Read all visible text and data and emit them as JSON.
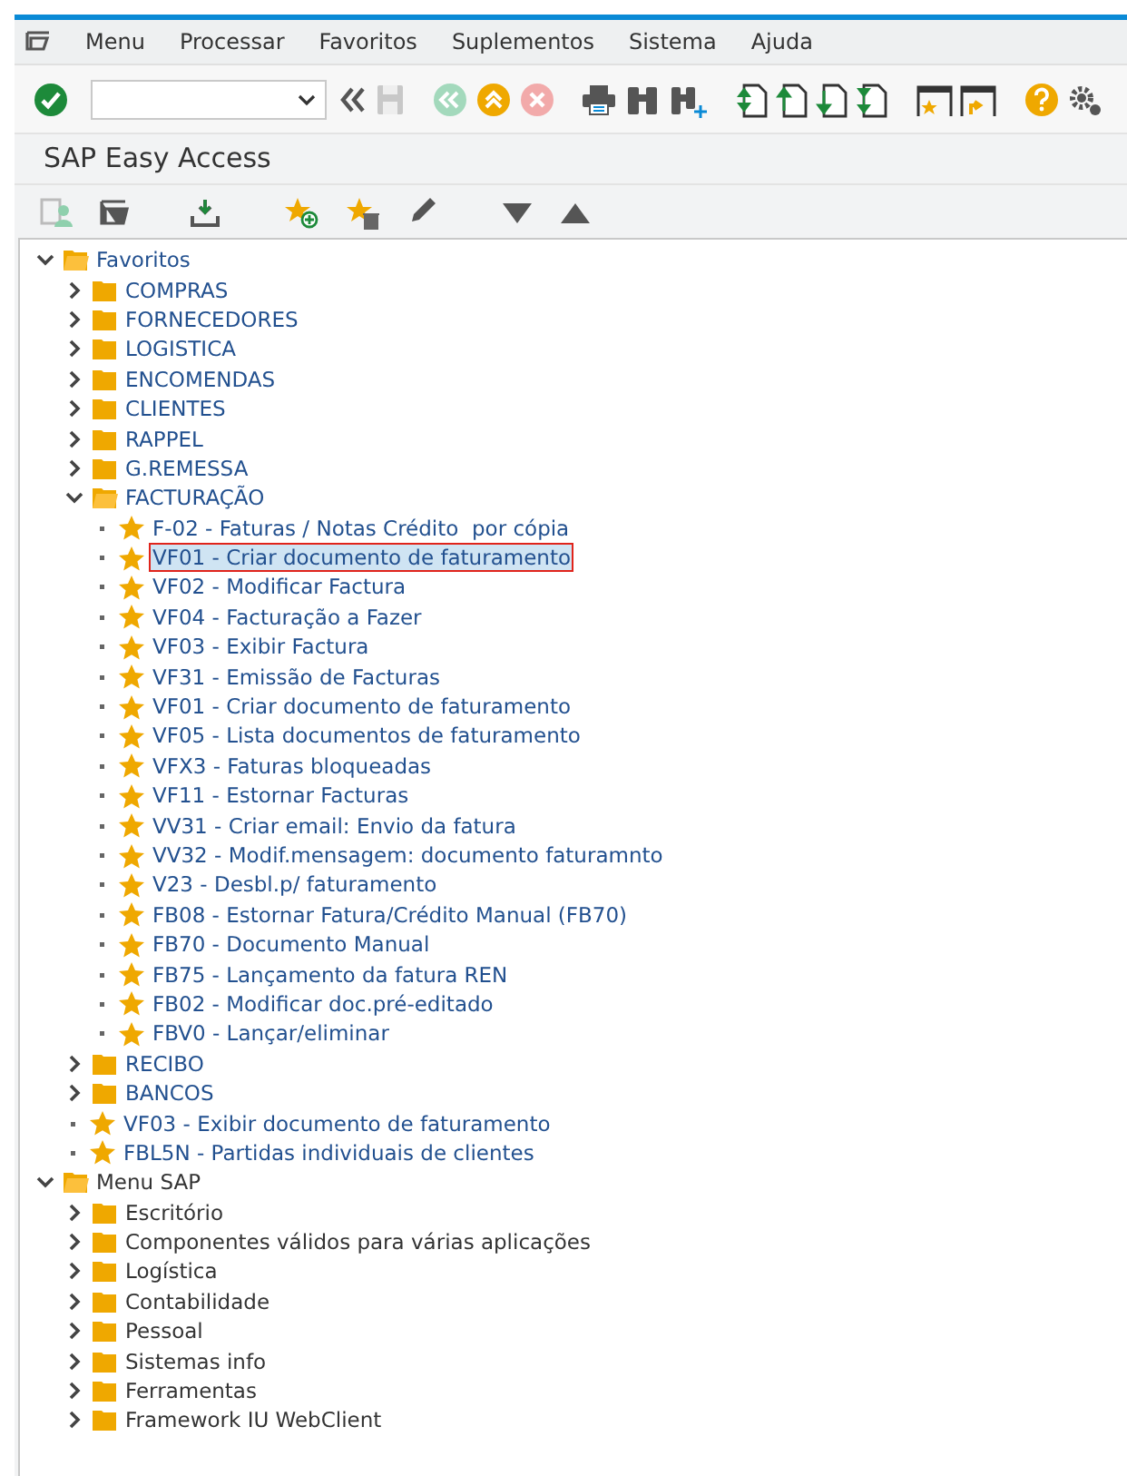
{
  "menu_bar": {
    "items": [
      "Menu",
      "Processar",
      "Favoritos",
      "Suplementos",
      "Sistema",
      "Ajuda"
    ]
  },
  "screen_title": "SAP Easy Access",
  "tree": [
    {
      "kind": "folder",
      "label": "Favoritos",
      "expanded": true,
      "selected": false,
      "children": [
        {
          "kind": "folder",
          "label": "COMPRAS",
          "expanded": false,
          "selected": false
        },
        {
          "kind": "folder",
          "label": "FORNECEDORES",
          "expanded": false,
          "selected": false
        },
        {
          "kind": "folder",
          "label": "LOGISTICA",
          "expanded": false,
          "selected": false
        },
        {
          "kind": "folder",
          "label": "ENCOMENDAS",
          "expanded": false,
          "selected": false
        },
        {
          "kind": "folder",
          "label": "CLIENTES",
          "expanded": false,
          "selected": false
        },
        {
          "kind": "folder",
          "label": "RAPPEL",
          "expanded": false,
          "selected": false
        },
        {
          "kind": "folder",
          "label": "G.REMESSA",
          "expanded": false,
          "selected": false
        },
        {
          "kind": "folder",
          "label": "FACTURAÇÃO",
          "expanded": true,
          "selected": false,
          "children": [
            {
              "kind": "transaction",
              "label": "F-02 - Faturas / Notas Crédito  por cópia",
              "selected": false
            },
            {
              "kind": "transaction",
              "label": "VF01 - Criar documento de faturamento",
              "selected": true
            },
            {
              "kind": "transaction",
              "label": "VF02 - Modificar Factura",
              "selected": false
            },
            {
              "kind": "transaction",
              "label": "VF04 - Facturação a Fazer",
              "selected": false
            },
            {
              "kind": "transaction",
              "label": "VF03 - Exibir Factura",
              "selected": false
            },
            {
              "kind": "transaction",
              "label": "VF31 - Emissão de Facturas",
              "selected": false
            },
            {
              "kind": "transaction",
              "label": "VF01 - Criar documento de faturamento",
              "selected": false
            },
            {
              "kind": "transaction",
              "label": "VF05 - Lista documentos de faturamento",
              "selected": false
            },
            {
              "kind": "transaction",
              "label": "VFX3 - Faturas bloqueadas",
              "selected": false
            },
            {
              "kind": "transaction",
              "label": "VF11 - Estornar Facturas",
              "selected": false
            },
            {
              "kind": "transaction",
              "label": "VV31 - Criar email: Envio da fatura",
              "selected": false
            },
            {
              "kind": "transaction",
              "label": "VV32 - Modif.mensagem: documento faturamnto",
              "selected": false
            },
            {
              "kind": "transaction",
              "label": "V23 - Desbl.p/ faturamento",
              "selected": false
            },
            {
              "kind": "transaction",
              "label": "FB08 - Estornar Fatura/Crédito Manual (FB70)",
              "selected": false
            },
            {
              "kind": "transaction",
              "label": "FB70 - Documento Manual",
              "selected": false
            },
            {
              "kind": "transaction",
              "label": "FB75 - Lançamento da fatura REN",
              "selected": false
            },
            {
              "kind": "transaction",
              "label": "FB02 - Modificar doc.pré-editado",
              "selected": false
            },
            {
              "kind": "transaction",
              "label": "FBV0 - Lançar/eliminar",
              "selected": false
            }
          ]
        },
        {
          "kind": "folder",
          "label": "RECIBO",
          "expanded": false,
          "selected": false
        },
        {
          "kind": "folder",
          "label": "BANCOS",
          "expanded": false,
          "selected": false
        },
        {
          "kind": "transaction",
          "label": "VF03 - Exibir documento de faturamento",
          "selected": false
        },
        {
          "kind": "transaction",
          "label": "FBL5N - Partidas individuais de clientes",
          "selected": false
        }
      ]
    },
    {
      "kind": "menu_folder",
      "label": "Menu SAP",
      "expanded": true,
      "selected": false,
      "children": [
        {
          "kind": "menu_folder",
          "label": "Escritório",
          "expanded": false,
          "selected": false
        },
        {
          "kind": "menu_folder",
          "label": "Componentes válidos para várias aplicações",
          "expanded": false,
          "selected": false
        },
        {
          "kind": "menu_folder",
          "label": "Logística",
          "expanded": false,
          "selected": false
        },
        {
          "kind": "menu_folder",
          "label": "Contabilidade",
          "expanded": false,
          "selected": false
        },
        {
          "kind": "menu_folder",
          "label": "Pessoal",
          "expanded": false,
          "selected": false
        },
        {
          "kind": "menu_folder",
          "label": "Sistemas info",
          "expanded": false,
          "selected": false
        },
        {
          "kind": "menu_folder",
          "label": "Ferramentas",
          "expanded": false,
          "selected": false
        },
        {
          "kind": "menu_folder",
          "label": "Framework IU WebClient",
          "expanded": false,
          "selected": false
        }
      ]
    }
  ]
}
